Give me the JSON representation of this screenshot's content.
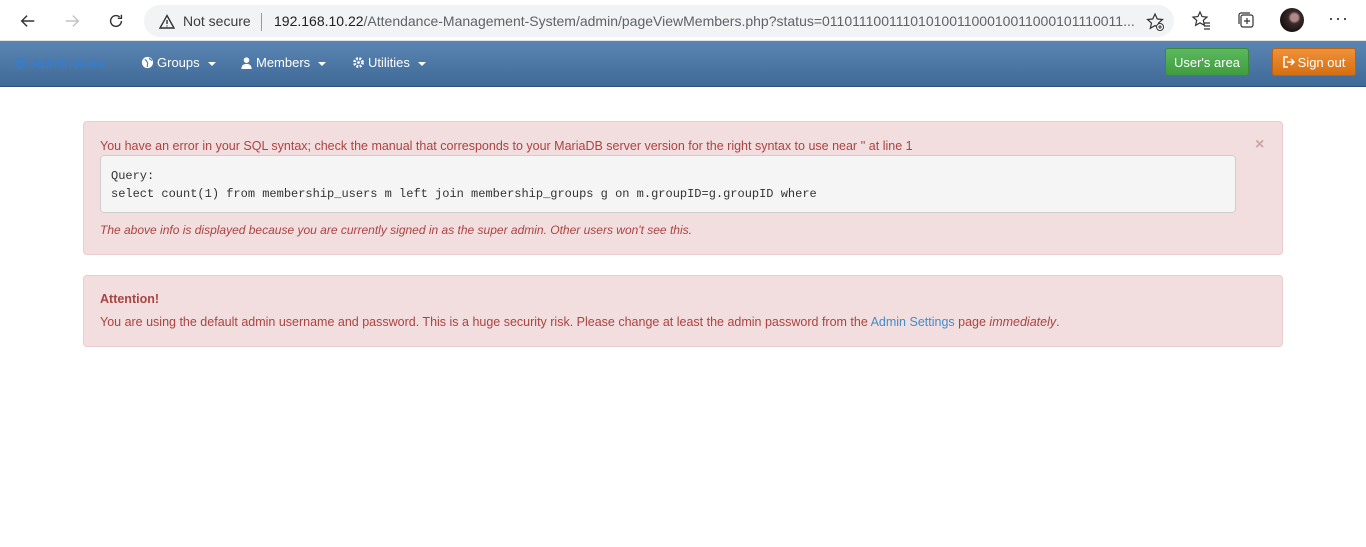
{
  "browser": {
    "security_label": "Not secure",
    "url_host": "192.168.10.22",
    "url_path": "/Attendance-Management-System/admin/pageViewMembers.php?status=0110111001110101001100010011000101110011..."
  },
  "navbar": {
    "brand": "Admin Area",
    "groups_label": "Groups",
    "members_label": "Members",
    "utilities_label": "Utilities",
    "users_area_label": "User's area",
    "sign_out_label": "Sign out"
  },
  "sql_error": {
    "message": "You have an error in your SQL syntax; check the manual that corresponds to your MariaDB server version for the right syntax to use near '' at line 1",
    "query_label": "Query:",
    "query": "select count(1) from membership_users m left join membership_groups g on m.groupID=g.groupID where",
    "note": "The above info is displayed because you are currently signed in as the super admin. Other users won't see this.",
    "close": "×"
  },
  "attention": {
    "title": "Attention!",
    "message_before": "You are using the default admin username and password. This is a huge security risk. Please change at least the admin password from the ",
    "link_text": "Admin Settings",
    "message_middle": " page ",
    "message_emphasis": "immediately",
    "message_end": "."
  },
  "colors": {
    "navbar": "#4a76a8",
    "alert_bg": "#f2dede",
    "alert_text": "#a94442",
    "success": "#5cb85c",
    "warning": "#f0ad4e"
  },
  "icons": [
    "back-arrow-icon",
    "forward-arrow-icon",
    "reload-icon",
    "warning-icon",
    "add-favorite-icon",
    "favorites-icon",
    "collections-icon",
    "more-icon",
    "cog-icon",
    "globe-icon",
    "user-icon",
    "sign-out-icon"
  ]
}
